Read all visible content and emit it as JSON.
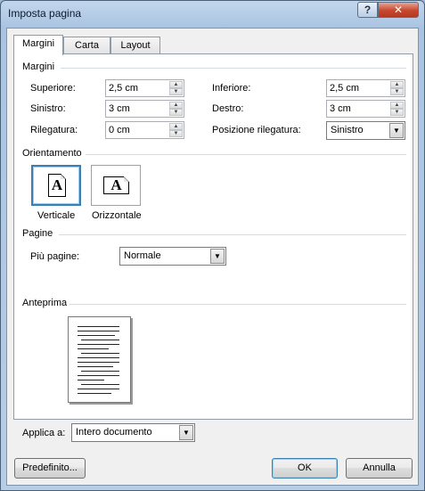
{
  "window": {
    "title": "Imposta pagina",
    "help_glyph": "?",
    "close_glyph": "✕"
  },
  "tabs": [
    {
      "label": "Margini",
      "active": true
    },
    {
      "label": "Carta",
      "active": false
    },
    {
      "label": "Layout",
      "active": false
    }
  ],
  "margins": {
    "section_title": "Margini",
    "top": {
      "label": "Superiore:",
      "value": "2,5 cm"
    },
    "bottom": {
      "label": "Inferiore:",
      "value": "2,5 cm"
    },
    "left": {
      "label": "Sinistro:",
      "value": "3 cm"
    },
    "right": {
      "label": "Destro:",
      "value": "3 cm"
    },
    "gutter": {
      "label": "Rilegatura:",
      "value": "0 cm"
    },
    "gutter_position": {
      "label": "Posizione rilegatura:",
      "value": "Sinistro"
    }
  },
  "orientation": {
    "section_title": "Orientamento",
    "portrait": {
      "label": "Verticale",
      "glyph": "A",
      "selected": true
    },
    "landscape": {
      "label": "Orizzontale",
      "glyph": "A",
      "selected": false
    }
  },
  "pages": {
    "section_title": "Pagine",
    "multiple_label": "Più pagine:",
    "multiple_value": "Normale"
  },
  "preview": {
    "section_title": "Anteprima",
    "apply_label": "Applica a:",
    "apply_value": "Intero documento"
  },
  "buttons": {
    "default": "Predefinito...",
    "ok": "OK",
    "cancel": "Annulla"
  },
  "icons": {
    "spin_up": "▲",
    "spin_down": "▼",
    "dropdown": "▼",
    "portrait": "portrait-orientation-icon",
    "landscape": "landscape-orientation-icon"
  }
}
